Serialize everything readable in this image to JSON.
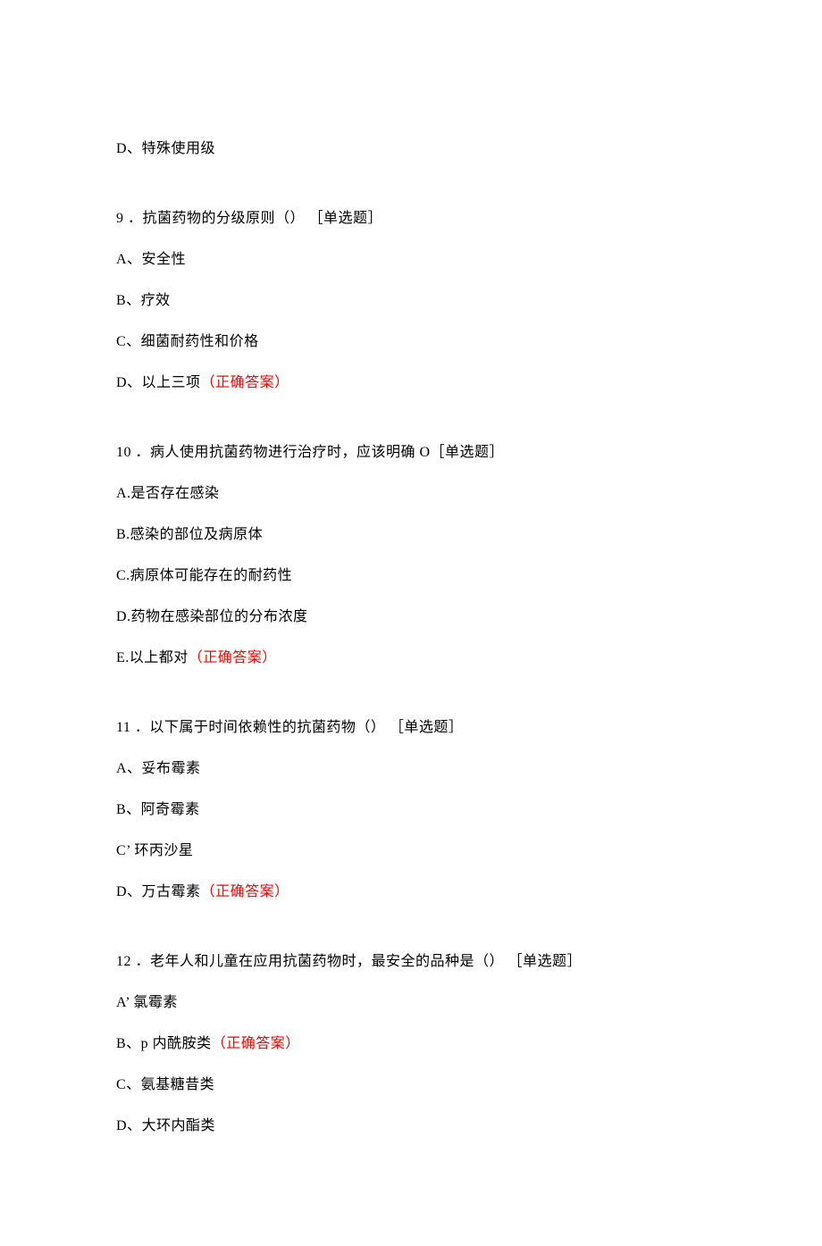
{
  "lead": {
    "optionD": "D、特殊使用级"
  },
  "q9": {
    "stem": "9 ．抗菌药物的分级原则（） ［单选题］",
    "a": "A、安全性",
    "b": "B、疗效",
    "c": "C、细菌耐药性和价格",
    "d_prefix": "D、以上三项",
    "d_answer": "（正确答案）"
  },
  "q10": {
    "stem": "10 ．病人使用抗菌药物进行治疗时，应该明确 O［单选题］",
    "a": "A.是否存在感染",
    "b": "B.感染的部位及病原体",
    "c": "C.病原体可能存在的耐药性",
    "d": "D.药物在感染部位的分布浓度",
    "e_prefix": "E.以上都对",
    "e_answer": "（正确答案）"
  },
  "q11": {
    "stem": "11 ．以下属于时间依赖性的抗菌药物（） ［单选题］",
    "a": "A、妥布霉素",
    "b": "B、阿奇霉素",
    "c": "C’ 环丙沙星",
    "d_prefix": "D、万古霉素",
    "d_answer": "（正确答案）"
  },
  "q12": {
    "stem": "12 ．老年人和儿童在应用抗菌药物时，最安全的品种是（） ［单选题］",
    "a": "A’ 氯霉素",
    "b_prefix": "B、p 内酰胺类",
    "b_answer": "（正确答案）",
    "c": "C、氨基糖昔类",
    "d": "D、大环内酯类"
  }
}
